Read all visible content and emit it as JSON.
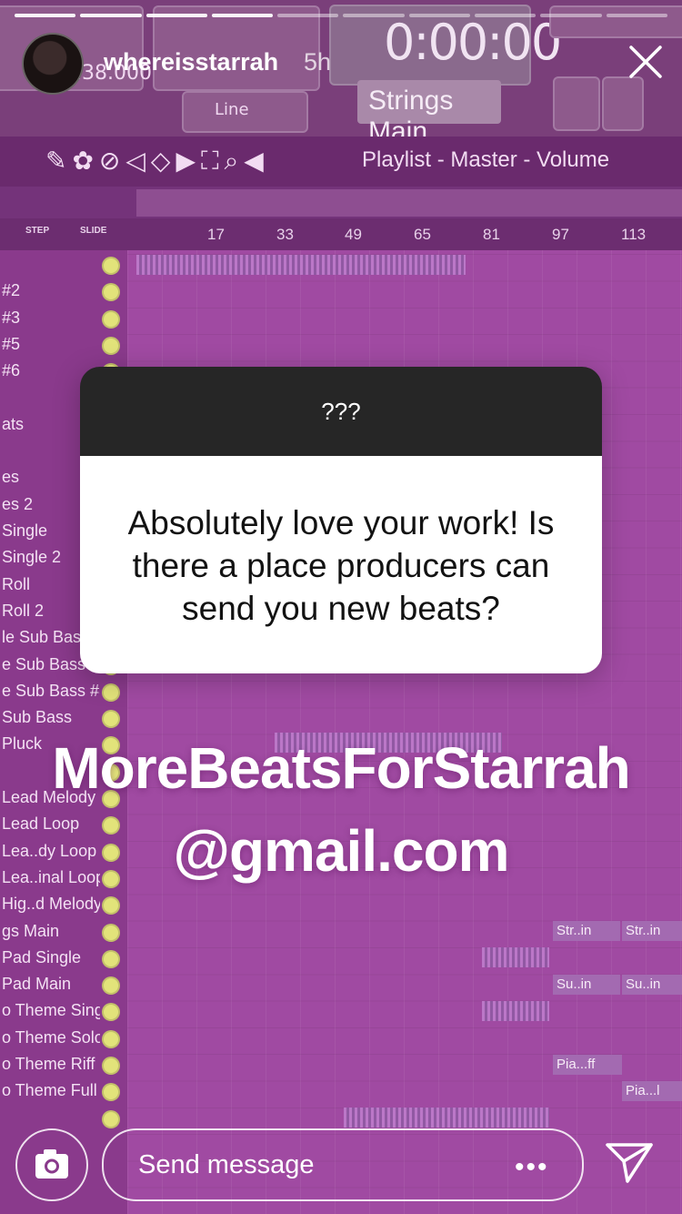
{
  "story": {
    "username": "whereisstarrah",
    "time_ago": "5h",
    "progress_segments": 10,
    "active_segment": 4,
    "question": {
      "header": "???",
      "text": "Absolutely love your work! Is there a place producers can send you new beats?"
    },
    "overlay_text": {
      "line1": "MoreBeatsForStarrah",
      "line2": "@gmail.com"
    },
    "reply": {
      "placeholder": "Send message",
      "more": "•••"
    }
  },
  "background_daw": {
    "time_display": "0:00:00",
    "tempo": "138.000",
    "pattern_name": "Strings Main",
    "snap": "Line",
    "playlist_title": "Playlist - Master - Volume",
    "step_label": "STEP",
    "slide_label": "SLIDE",
    "ruler_ticks": [
      "17",
      "33",
      "49",
      "65",
      "81",
      "97",
      "113"
    ],
    "channels": [
      "",
      "#2",
      "#3",
      "#5",
      "#6",
      "",
      "ats",
      "",
      "es",
      "es 2",
      "Single",
      "Single 2",
      "Roll",
      "Roll 2",
      "le Sub Bass",
      "e Sub Bass",
      "e Sub Bass #3",
      "Sub Bass",
      "Pluck",
      "",
      "Lead Melody",
      "Lead Loop",
      "Lea..dy Loop 2",
      "Lea..inal Loop",
      "Hig..d Melody",
      "gs Main",
      "Pad Single",
      "Pad Main",
      "o Theme Single",
      "o Theme Solo",
      "o Theme Riff",
      "o Theme Full",
      ""
    ],
    "clips": [
      "Str..in",
      "Str..in",
      "Su..in",
      "Su..in",
      "Pia...ff",
      "Pia...l"
    ]
  },
  "colors": {
    "tint": "#a04aa2",
    "card_header": "#262626",
    "card_body": "#ffffff",
    "text_on_tint": "#ffffff"
  }
}
